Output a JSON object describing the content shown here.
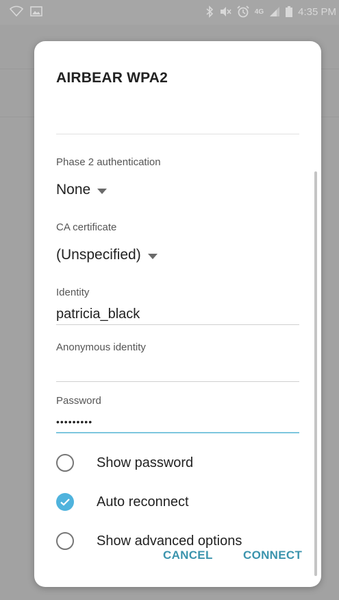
{
  "status_bar": {
    "time": "4:35 PM",
    "network_label": "4G"
  },
  "dialog": {
    "title": "AIRBEAR WPA2",
    "phase2": {
      "label": "Phase 2 authentication",
      "value": "None"
    },
    "ca_certificate": {
      "label": "CA certificate",
      "value": "(Unspecified)"
    },
    "identity": {
      "label": "Identity",
      "value": "patricia_black"
    },
    "anonymous_identity": {
      "label": "Anonymous identity",
      "value": ""
    },
    "password": {
      "label": "Password",
      "value": "•••••••••"
    },
    "options": [
      {
        "label": "Show password",
        "checked": false
      },
      {
        "label": "Auto reconnect",
        "checked": true
      },
      {
        "label": "Show advanced options",
        "checked": false
      }
    ],
    "buttons": {
      "cancel": "CANCEL",
      "connect": "CONNECT"
    }
  },
  "colors": {
    "accent": "#4fb3dd",
    "button_text": "#3b94ad",
    "active_underline": "#7cc6de"
  }
}
